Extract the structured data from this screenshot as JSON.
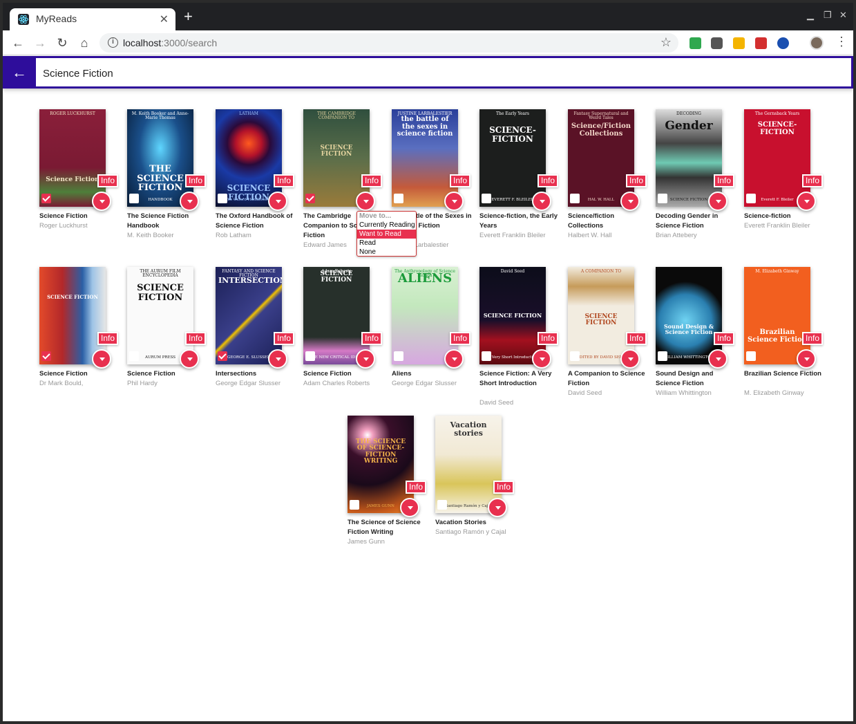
{
  "browser": {
    "tab_title": "MyReads",
    "url_host": "localhost",
    "url_path": ":3000/search"
  },
  "search": {
    "query": "Science Fiction"
  },
  "colors": {
    "accent": "#2e0d9b",
    "button_red": "#e8304f"
  },
  "shelf_menu": {
    "options": [
      "Move to...",
      "Currently Reading",
      "Want to Read",
      "Read",
      "None"
    ],
    "selected": "Want to Read"
  },
  "books": [
    {
      "title": "Science Fiction",
      "author": "Roger Luckhurst",
      "checked": true,
      "cover_text": "Science Fiction",
      "cover_top": "ROGER LUCKHURST"
    },
    {
      "title": "The Science Fiction Handbook",
      "author": "M. Keith Booker",
      "checked": false,
      "cover_text": "THE SCIENCE FICTION",
      "cover_top": "M. Keith Booker and Anne-Marie Thomas",
      "cover_bottom": "HANDBOOK"
    },
    {
      "title": "The Oxford Handbook of Science Fiction",
      "author": "Rob Latham",
      "checked": false,
      "cover_text": "SCIENCE FICTION",
      "cover_top": "LATHAM",
      "cover_bottom": "The Oxford Handbook of"
    },
    {
      "title": "The Cambridge Companion to Science Fiction",
      "author": "Edward James",
      "checked": true,
      "cover_text": "SCIENCE FICTION",
      "cover_top": "THE CAMBRIDGE COMPANION TO"
    },
    {
      "title": "The Battle of the Sexes in Science Fiction",
      "author": "Justine Larbalestier",
      "checked": false,
      "cover_text": "the battle of the sexes in science fiction",
      "cover_top": "JUSTINE LARBALESTIER"
    },
    {
      "title": "Science-fiction, the Early Years",
      "author": "Everett Franklin Bleiler",
      "checked": false,
      "cover_text": "SCIENCE-FICTION",
      "cover_top": "The Early Years",
      "cover_bottom": "EVERETT F. BLEILER"
    },
    {
      "title": "Science/fiction Collections",
      "author": "Halbert W. Hall",
      "checked": false,
      "cover_text": "Science/Fiction Collections",
      "cover_top": "Fantasy Supernatural and Weird Tales",
      "cover_bottom": "HAL W. HALL"
    },
    {
      "title": "Decoding Gender in Science Fiction",
      "author": "Brian Attebery",
      "checked": false,
      "cover_text": "Gender",
      "cover_top": "DECODING",
      "cover_bottom": "SCIENCE FICTION"
    },
    {
      "title": "Science-fiction",
      "author": "Everett Franklin Bleiler",
      "checked": false,
      "cover_text": "SCIENCE-FICTION",
      "cover_top": "The Gernsback Years",
      "cover_bottom": "Everett F. Bleiler"
    },
    {
      "title": "Science Fiction",
      "author": "Dr Mark Bould,",
      "checked": true,
      "cover_text": "SCIENCE FICTION",
      "cover_top": "",
      "cover_bottom": ""
    },
    {
      "title": "Science Fiction",
      "author": "Phil Hardy",
      "checked": false,
      "cover_text": "SCIENCE FICTION",
      "cover_top": "THE AURUM FILM ENCYCLOPEDIA",
      "cover_bottom": "AURUM PRESS"
    },
    {
      "title": "Intersections",
      "author": "George Edgar Slusser",
      "checked": true,
      "cover_text": "INTERSECTIONS",
      "cover_top": "FANTASY AND SCIENCE FICTION",
      "cover_bottom": "GEORGE E. SLUSSER"
    },
    {
      "title": "Science Fiction",
      "author": "Adam Charles Roberts",
      "checked": false,
      "cover_text": "SCIENCE FICTION",
      "cover_top": "Adam Roberts",
      "cover_bottom": "THE NEW CRITICAL IDIOM"
    },
    {
      "title": "Aliens",
      "author": "George Edgar Slusser",
      "checked": false,
      "cover_text": "ALIENS",
      "cover_top": "The Anthropology of Science Fiction",
      "cover_bottom": ""
    },
    {
      "title": "Science Fiction: A Very Short Introduction",
      "author": "David Seed",
      "checked": false,
      "cover_text": "SCIENCE FICTION",
      "cover_top": "David Seed",
      "cover_bottom": "A Very Short Introduction"
    },
    {
      "title": "A Companion to Science Fiction",
      "author": "David Seed",
      "checked": false,
      "cover_text": "SCIENCE FICTION",
      "cover_top": "A COMPANION TO",
      "cover_bottom": "EDITED BY DAVID SEED"
    },
    {
      "title": "Sound Design and Science Fiction",
      "author": "William Whittington",
      "checked": false,
      "cover_text": "Sound Design & Science Fiction",
      "cover_top": "",
      "cover_bottom": "WILLIAM WHITTINGTON"
    },
    {
      "title": "Brazilian Science Fiction",
      "author": "M. Elizabeth Ginway",
      "checked": false,
      "cover_text": "Brazilian Science Fiction",
      "cover_top": "M. Elizabeth Ginway",
      "cover_bottom": ""
    },
    {
      "title": "The Science of Science Fiction Writing",
      "author": "James Gunn",
      "checked": false,
      "cover_text": "THE SCIENCE OF SCIENCE-FICTION WRITING",
      "cover_top": "",
      "cover_bottom": "JAMES GUNN"
    },
    {
      "title": "Vacation Stories",
      "author": "Santiago Ramón y Cajal",
      "checked": false,
      "cover_text": "Vacation stories",
      "cover_top": "",
      "cover_bottom": "Santiago Ramón y Cajal"
    }
  ]
}
